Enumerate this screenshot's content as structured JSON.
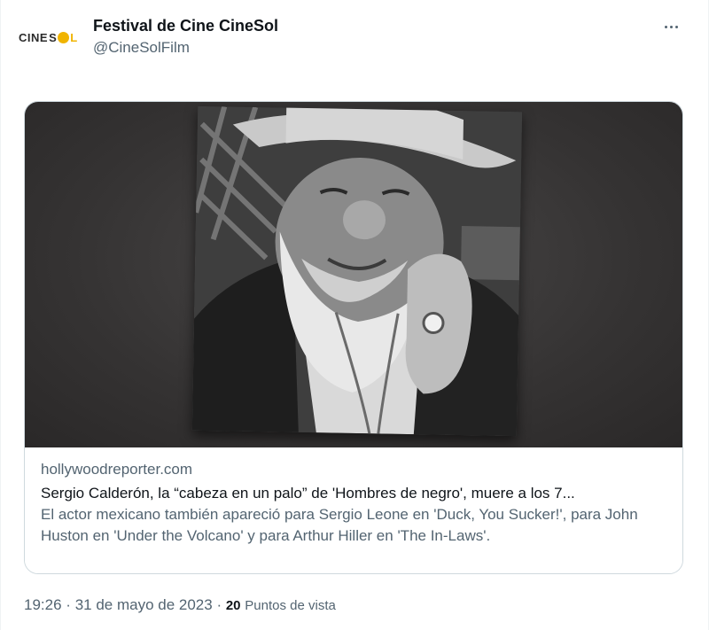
{
  "account": {
    "display_name": "Festival de Cine CineSol",
    "handle": "@CineSolFilm",
    "logo_left": "CINE",
    "logo_right": "L",
    "logo_mid": "S"
  },
  "menu": {
    "icon": "more-horizontal-icon"
  },
  "card": {
    "domain": "hollywoodreporter.com",
    "title": "Sergio Calderón, la “cabeza en un palo” de 'Hombres de negro', muere a los 7...",
    "description": "El actor mexicano también apareció para Sergio Leone en 'Duck, You Sucker!', para John Huston en 'Under the Volcano' y para Arthur Hiller en 'The In-Laws'."
  },
  "footer": {
    "time": "19:26",
    "separator": "·",
    "date": "31 de mayo de 2023",
    "views_count": "20",
    "views_label": "Puntos de vista"
  },
  "colors": {
    "text_primary": "#0f1419",
    "text_secondary": "#536471",
    "border": "#cfd9de",
    "logo_accent": "#f0b400"
  }
}
